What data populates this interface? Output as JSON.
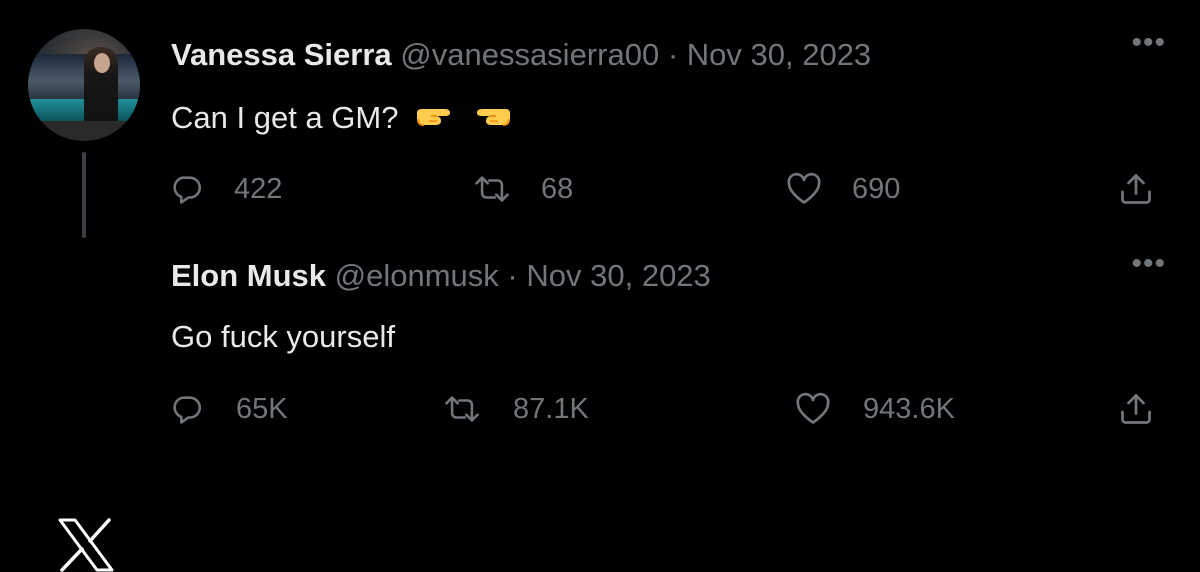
{
  "tweets": [
    {
      "author": {
        "name": "Vanessa Sierra",
        "handle": "@vanessasierra00",
        "avatar": "profile-photo"
      },
      "separator": "·",
      "date": "Nov 30, 2023",
      "text": "Can I get a GM?",
      "emojis": [
        "backhand-index-pointing-right",
        "backhand-index-pointing-left"
      ],
      "more_icon": "more-icon",
      "more_label": "•••",
      "stats": {
        "replies": "422",
        "retweets": "68",
        "likes": "690"
      }
    },
    {
      "author": {
        "name": "Elon Musk",
        "handle": "@elonmusk",
        "avatar": "x-logo"
      },
      "separator": "·",
      "date": "Nov 30, 2023",
      "text": "Go fuck yourself",
      "more_icon": "more-icon",
      "more_label": "•••",
      "stats": {
        "replies": "65K",
        "retweets": "87.1K",
        "likes": "943.6K"
      }
    }
  ],
  "icons": {
    "reply": "reply-icon",
    "retweet": "retweet-icon",
    "like": "heart-icon",
    "share": "share-icon"
  },
  "colors": {
    "background": "#000000",
    "primary_text": "#e7e9ea",
    "secondary_text": "#71767b",
    "thread_line": "#3a3d41"
  }
}
